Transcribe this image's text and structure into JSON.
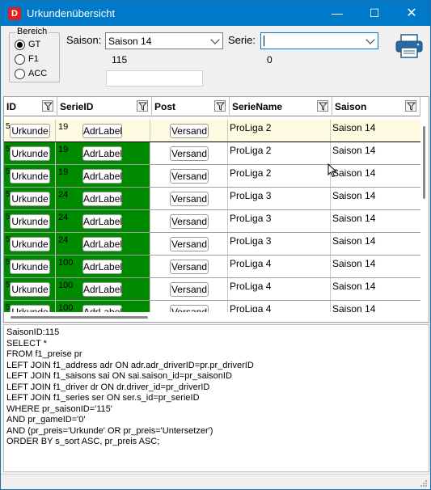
{
  "window": {
    "title": "Urkundenübersicht",
    "app_icon_letter": "D",
    "minimize_glyph": "—",
    "maximize_glyph": "☐",
    "close_glyph": "✕"
  },
  "bereich": {
    "legend": "Bereich",
    "options": [
      "GT",
      "F1",
      "ACC"
    ],
    "selected": "GT"
  },
  "filters": {
    "saison_label": "Saison:",
    "saison_value": "Saison 14",
    "saison_count": "115",
    "serie_label": "Serie:",
    "serie_value": "",
    "serie_count": "0"
  },
  "grid": {
    "columns": [
      "ID",
      "SerieID",
      "Post",
      "SerieName",
      "Saison"
    ],
    "button_urkunde": "Urkunde",
    "button_adrlabel": "AdrLabel",
    "button_versand": "Versand",
    "rows": [
      {
        "id": "5",
        "serie_id": "19",
        "serie_name": "ProLiga 2",
        "saison": "Saison 14",
        "selected": true
      },
      {
        "id": "5",
        "serie_id": "19",
        "serie_name": "ProLiga 2",
        "saison": "Saison 14",
        "selected": false
      },
      {
        "id": "5",
        "serie_id": "19",
        "serie_name": "ProLiga 2",
        "saison": "Saison 14",
        "selected": false
      },
      {
        "id": "5",
        "serie_id": "24",
        "serie_name": "ProLiga 3",
        "saison": "Saison 14",
        "selected": false
      },
      {
        "id": "5",
        "serie_id": "24",
        "serie_name": "ProLiga 3",
        "saison": "Saison 14",
        "selected": false
      },
      {
        "id": "5",
        "serie_id": "24",
        "serie_name": "ProLiga 3",
        "saison": "Saison 14",
        "selected": false
      },
      {
        "id": "5",
        "serie_id": "100",
        "serie_name": "ProLiga 4",
        "saison": "Saison 14",
        "selected": false
      },
      {
        "id": "5",
        "serie_id": "100",
        "serie_name": "ProLiga 4",
        "saison": "Saison 14",
        "selected": false
      },
      {
        "id": "5",
        "serie_id": "100",
        "serie_name": "ProLiga 4",
        "saison": "Saison 14",
        "selected": false
      }
    ]
  },
  "sql_text": "SaisonID:115\nSELECT *\nFROM f1_preise pr\nLEFT JOIN f1_address adr ON adr.adr_driverID=pr.pr_driverID\nLEFT JOIN f1_saisons sai ON sai.saison_id=pr_saisonID\nLEFT JOIN f1_driver dr ON dr.driver_id=pr_driverID\nLEFT JOIN f1_series ser ON ser.s_id=pr_serieID\nWHERE pr_saisonID='115'\nAND pr_gameID='0'\nAND (pr_preis='Urkunde' OR pr_preis='Untersetzer')\nORDER BY s_sort ASC, pr_preis ASC;",
  "colors": {
    "titlebar": "#0079c8",
    "row_green": "#008a00",
    "selected_row": "#fffbe0"
  },
  "icons": {
    "printer": "printer-icon",
    "filter": "filter-icon"
  }
}
